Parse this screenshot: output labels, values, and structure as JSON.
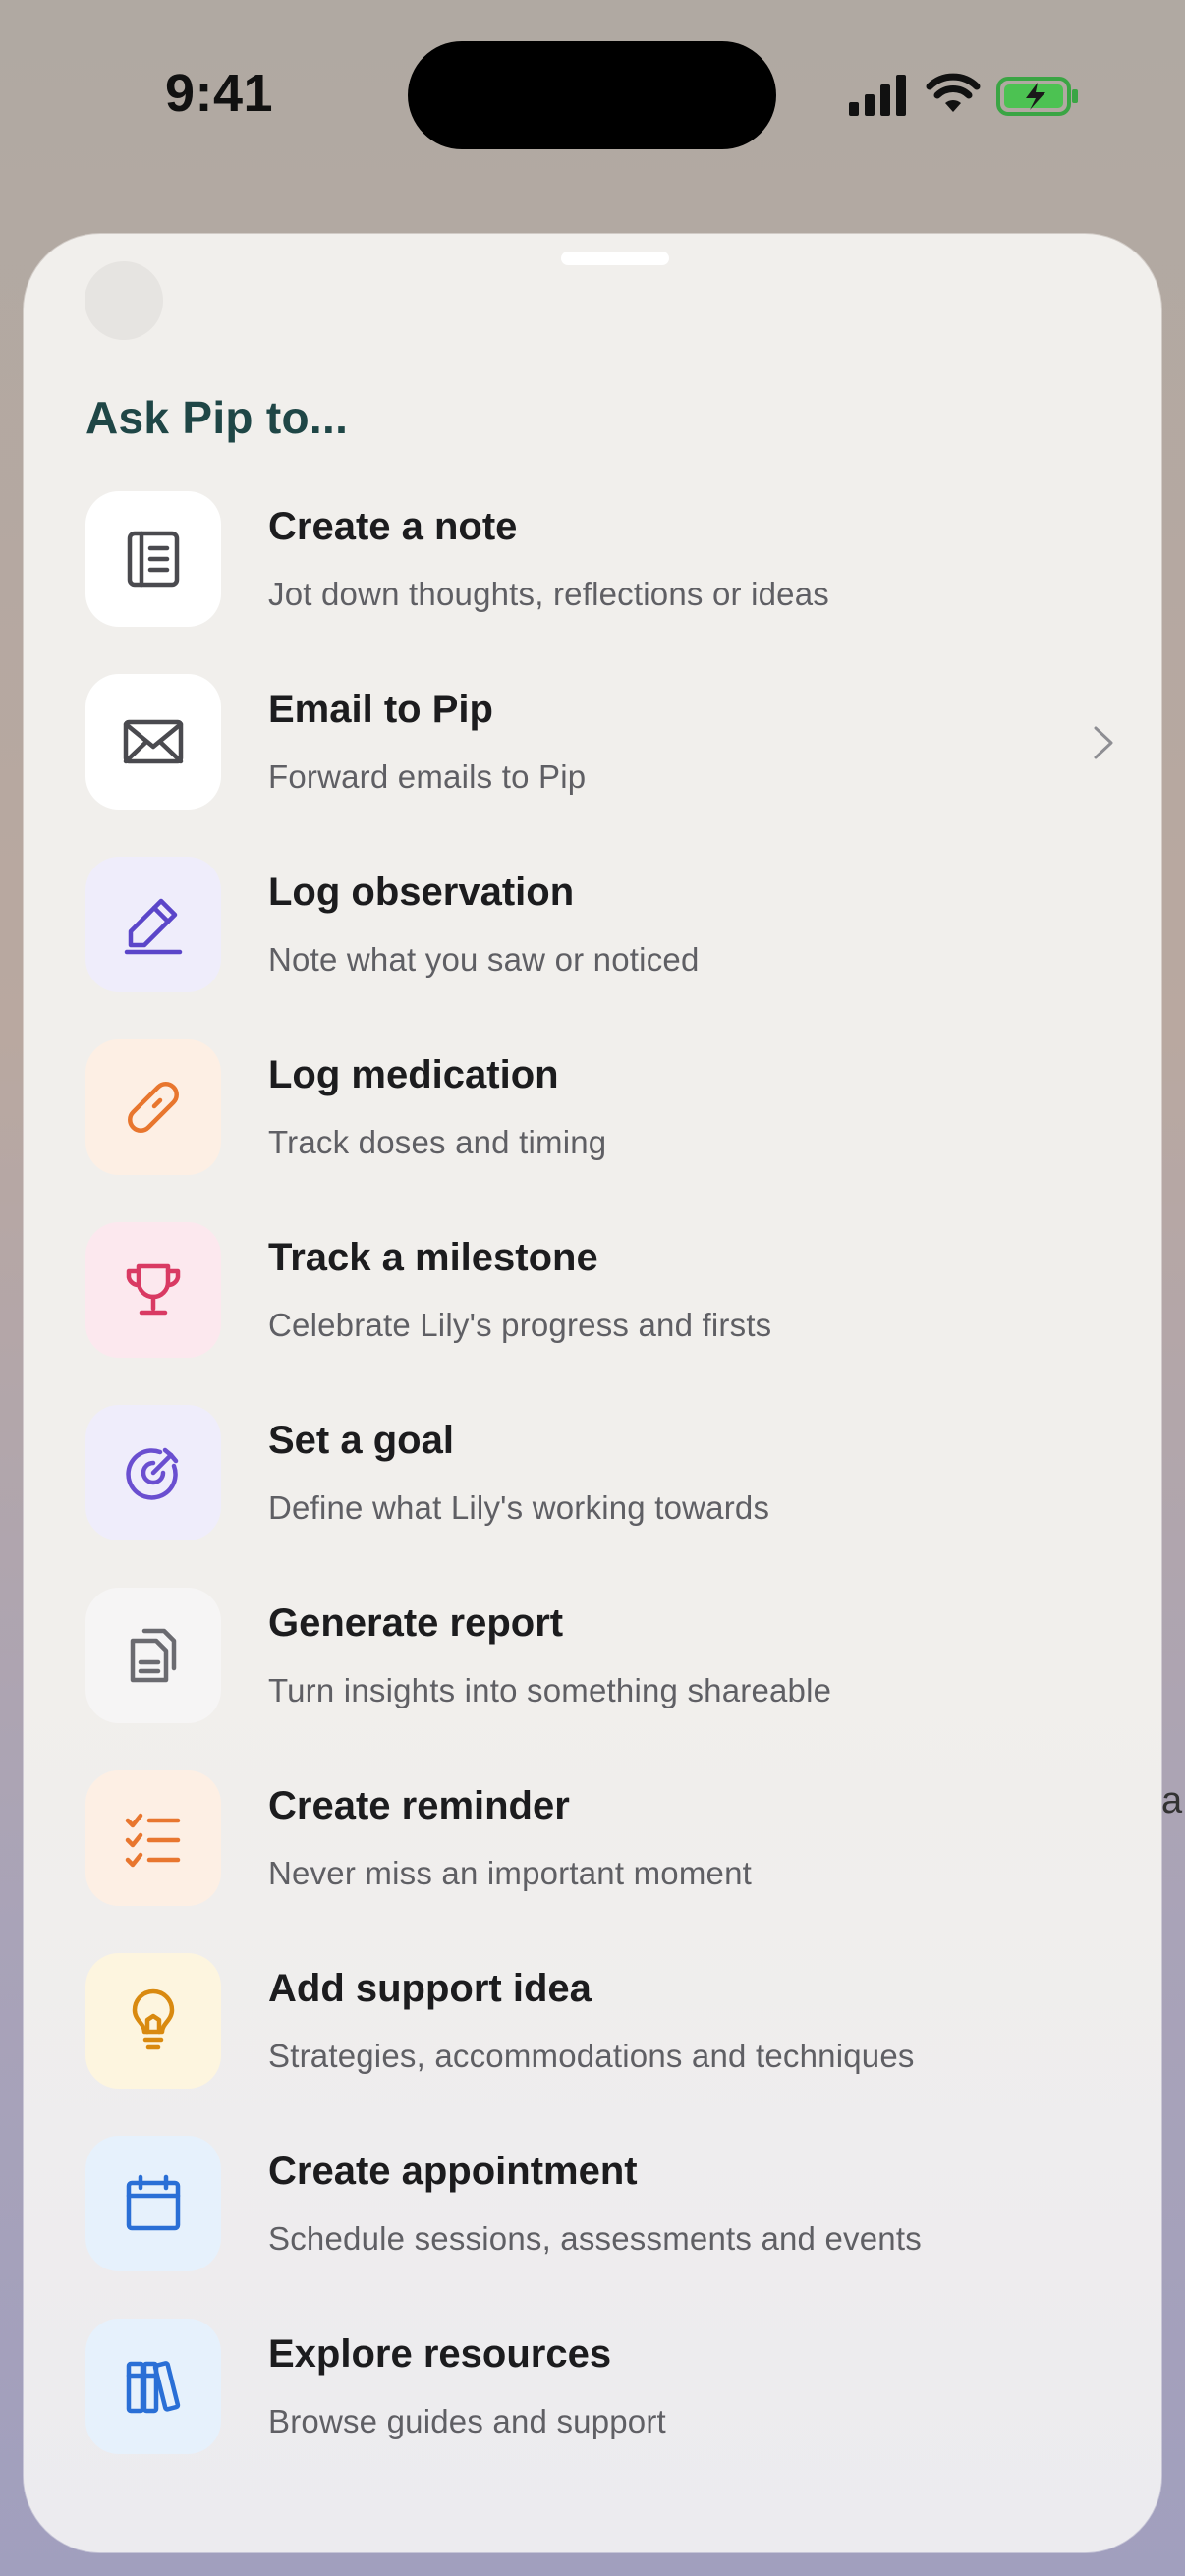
{
  "status_bar": {
    "time": "9:41"
  },
  "background": {
    "partial_text": "a"
  },
  "sheet": {
    "title": "Ask Pip to...",
    "items": [
      {
        "label": "Create a note",
        "subtitle": "Jot down thoughts, reflections or ideas",
        "icon": "note-icon",
        "color": "#4a4a4f",
        "tile_bg": "#ffffff"
      },
      {
        "label": "Email to Pip",
        "subtitle": "Forward emails to Pip",
        "icon": "mail-icon",
        "color": "#4a4a4f",
        "tile_bg": "#ffffff",
        "has_chevron": true
      },
      {
        "label": "Log observation",
        "subtitle": "Note what you saw or noticed",
        "icon": "pencil-icon",
        "color": "#5b46c9",
        "tile_bg": "#efedfb"
      },
      {
        "label": "Log medication",
        "subtitle": "Track doses and timing",
        "icon": "pill-icon",
        "color": "#e8762e",
        "tile_bg": "#fdefe4"
      },
      {
        "label": "Track a milestone",
        "subtitle": "Celebrate Lily's progress and firsts",
        "icon": "trophy-icon",
        "color": "#d93a63",
        "tile_bg": "#fce8ee"
      },
      {
        "label": "Set a goal",
        "subtitle": "Define what Lily's working towards",
        "icon": "target-icon",
        "color": "#6a4fd0",
        "tile_bg": "#efedfb"
      },
      {
        "label": "Generate report",
        "subtitle": "Turn insights into something shareable",
        "icon": "report-icon",
        "color": "#6b6b70",
        "tile_bg": "#f6f5f5"
      },
      {
        "label": "Create reminder",
        "subtitle": "Never miss an important moment",
        "icon": "checklist-icon",
        "color": "#e8762e",
        "tile_bg": "#fdefe4"
      },
      {
        "label": "Add support idea",
        "subtitle": "Strategies, accommodations and techniques",
        "icon": "lightbulb-icon",
        "color": "#d98a10",
        "tile_bg": "#fdf5df"
      },
      {
        "label": "Create appointment",
        "subtitle": "Schedule sessions, assessments and events",
        "icon": "calendar-icon",
        "color": "#2a6fd6",
        "tile_bg": "#e6f1fc"
      },
      {
        "label": "Explore resources",
        "subtitle": "Browse guides and support",
        "icon": "books-icon",
        "color": "#2a6fd6",
        "tile_bg": "#e6f1fc"
      }
    ]
  }
}
